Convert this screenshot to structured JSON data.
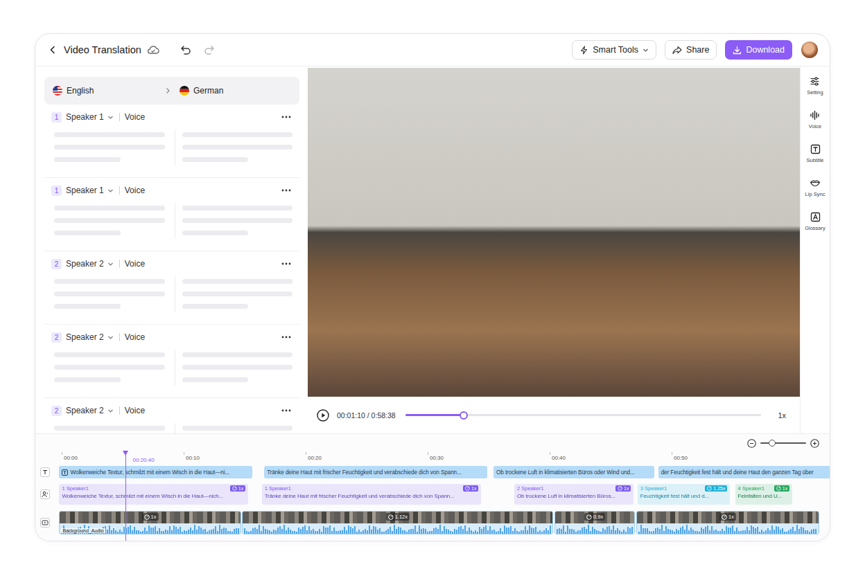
{
  "header": {
    "title": "Video Translation",
    "undo": {
      "disabled": false
    },
    "redo": {
      "disabled": true
    },
    "smart_tools": "Smart Tools",
    "share": "Share",
    "download": "Download"
  },
  "languages": {
    "source": {
      "label": "English",
      "kind": "us"
    },
    "target": {
      "label": "German",
      "kind": "de"
    }
  },
  "segments": [
    {
      "number": "1",
      "speaker": "Speaker 1",
      "voice": "Voice",
      "loading": true
    },
    {
      "number": "1",
      "speaker": "Speaker 1",
      "voice": "Voice",
      "loading": true
    },
    {
      "number": "2",
      "speaker": "Speaker 2",
      "voice": "Voice",
      "loading": true
    },
    {
      "number": "2",
      "speaker": "Speaker 2",
      "voice": "Voice",
      "loading": true
    },
    {
      "number": "2",
      "speaker": "Speaker 2",
      "voice": "Voice",
      "loading": true
    }
  ],
  "player": {
    "time": "00:01:10 / 0:58:38",
    "level": 0.165,
    "speed": "1x",
    "playing": false
  },
  "tools": [
    {
      "label": "Setting",
      "kind": "setting"
    },
    {
      "label": "Voice",
      "kind": "voice"
    },
    {
      "label": "Subtitle",
      "kind": "subtitle"
    },
    {
      "label": "Lip Sync",
      "kind": "lipsync"
    },
    {
      "label": "Glossary",
      "kind": "glossary"
    }
  ],
  "timeline": {
    "zoom": {
      "level": 0.25
    },
    "ticks": [
      {
        "label": "00:00",
        "at": 0
      },
      {
        "label": "00:10",
        "at": 10
      },
      {
        "label": "00:20",
        "at": 20
      },
      {
        "label": "00:30",
        "at": 30
      },
      {
        "label": "00:40",
        "at": 40
      },
      {
        "label": "00:50",
        "at": 50
      }
    ],
    "playhead": {
      "label": "00:20:40",
      "at": 5.2
    },
    "subtitles": [
      {
        "text": "Wolkenweiche Textur, schmilzt mit einem Wisch in die Haut—ni...",
        "start": -0.2,
        "end": 15.6,
        "kind": "labelled"
      },
      {
        "text": "Tränke deine Haut mit frischer Feuchtigkeit und verabschiede dich von Spann...",
        "start": 16.6,
        "end": 34.9,
        "kind": "plain"
      },
      {
        "text": "Ob trockene Luft in klimatisierten Büros oder Wind und...",
        "start": 35.4,
        "end": 48.6,
        "kind": "plain"
      },
      {
        "text": "der Feuchtigkeit fest hält und deine Haut den ganzen Tag über",
        "start": 48.9,
        "end": 64,
        "kind": "plain"
      }
    ],
    "voices": [
      {
        "number": "1",
        "speaker": "Speaker1",
        "speed": "1x",
        "text": "Wolkenweiche Textur, schmilzt mit einem Wisch in die Haut—nich...",
        "start": -0.2,
        "end": 15.3,
        "color": "#7c5cf0"
      },
      {
        "number": "1",
        "speaker": "Speaker1",
        "speed": "1x",
        "text": "Tränke deine Haut mit frischer Feuchtigkeit und verabschiede dich von Spann...",
        "start": 16.4,
        "end": 34.4,
        "color": "#7c5cf0"
      },
      {
        "number": "2",
        "speaker": "Speaker1",
        "speed": "1x",
        "text": "Ob trockene Luft in klimatisierten Büros...",
        "start": 37.1,
        "end": 46.9,
        "color": "#7c5cf0"
      },
      {
        "number": "3",
        "speaker": "Speaker1",
        "speed": "1.25x",
        "text": "Feuchtigkeit fest hält und d...",
        "start": 47.2,
        "end": 54.8,
        "color": "#1fb0d8"
      },
      {
        "number": "4",
        "speaker": "Speaker1",
        "speed": "1x",
        "text": "Feinfalten und U...",
        "start": 55.2,
        "end": 59.9,
        "color": "#23a862"
      }
    ],
    "video": [
      {
        "speed": "1x",
        "start": -0.2,
        "end": 14.7,
        "label": "Background_Audio"
      },
      {
        "speed": "1.12x",
        "start": 14.8,
        "end": 40.3
      },
      {
        "speed": "0.9x",
        "start": 40.4,
        "end": 47.0
      },
      {
        "speed": "1x",
        "start": 47.1,
        "end": 62.1
      }
    ]
  }
}
